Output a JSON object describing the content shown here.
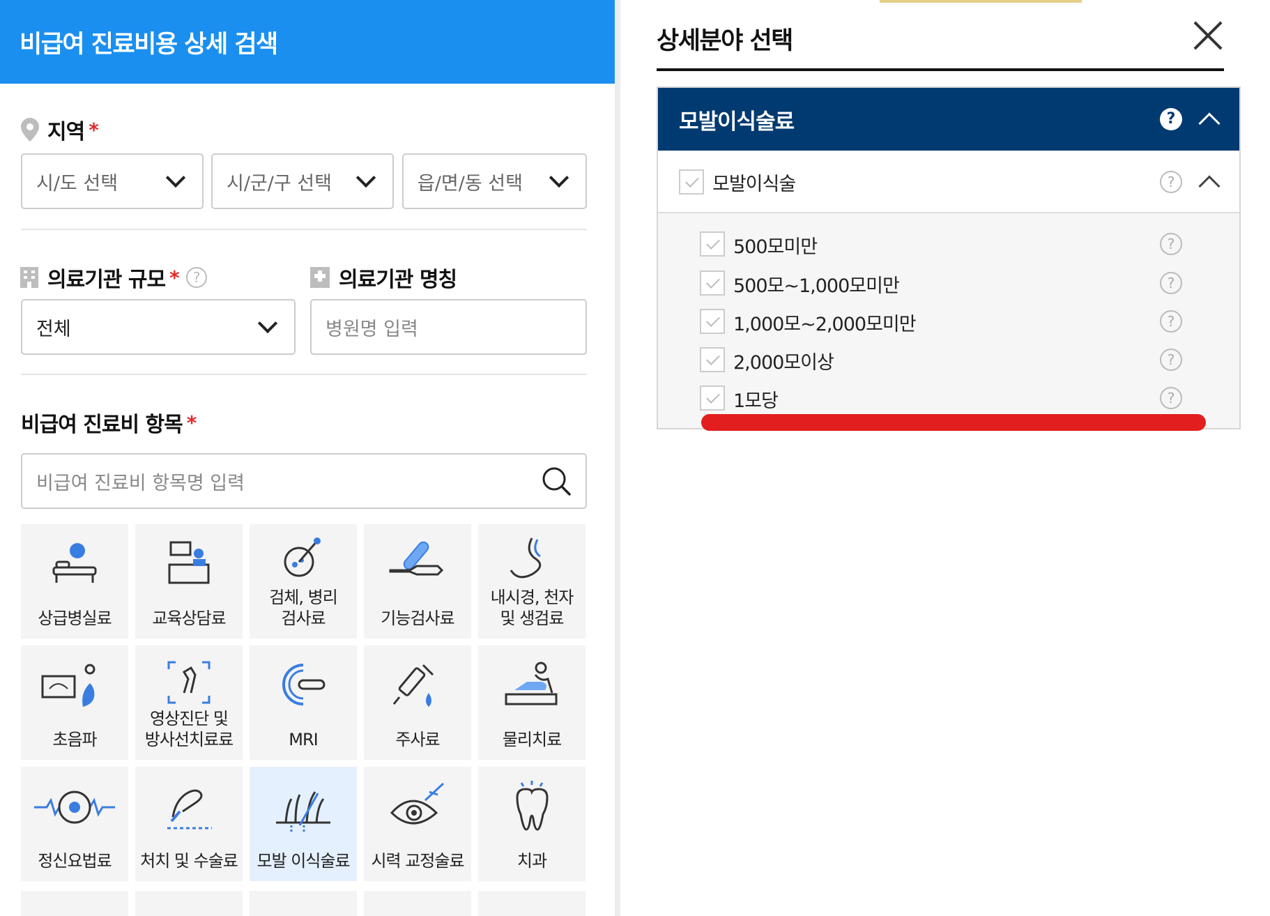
{
  "left": {
    "header_title": "비급여 진료비용 상세 검색",
    "region": {
      "label": "지역",
      "required_mark": "*",
      "sido_placeholder": "시/도 선택",
      "sigungu_placeholder": "시/군/구 선택",
      "dong_placeholder": "읍/면/동 선택"
    },
    "hospital_size": {
      "label": "의료기관 규모",
      "required_mark": "*",
      "help": "?",
      "value": "전체"
    },
    "hospital_name": {
      "label": "의료기관 명칭",
      "placeholder": "병원명 입력"
    },
    "items": {
      "label": "비급여 진료비 항목",
      "required_mark": "*",
      "search_placeholder": "비급여 진료비 항목명 입력",
      "tiles": [
        {
          "label": "상급병실료",
          "icon": "hospital-bed-icon"
        },
        {
          "label": "교육상담료",
          "icon": "counseling-desk-icon"
        },
        {
          "label": "검체, 병리\n검사료",
          "icon": "specimen-test-icon"
        },
        {
          "label": "기능검사료",
          "icon": "function-test-icon"
        },
        {
          "label": "내시경, 천자\n및 생검료",
          "icon": "endoscope-icon"
        },
        {
          "label": "초음파",
          "icon": "ultrasound-icon"
        },
        {
          "label": "영상진단 및\n방사선치료료",
          "icon": "xray-icon"
        },
        {
          "label": "MRI",
          "icon": "mri-icon"
        },
        {
          "label": "주사료",
          "icon": "syringe-icon"
        },
        {
          "label": "물리치료",
          "icon": "physio-icon"
        },
        {
          "label": "정신요법료",
          "icon": "brain-wave-icon"
        },
        {
          "label": "처치 및 수술료",
          "icon": "surgery-hand-icon"
        },
        {
          "label": "모발 이식술료",
          "icon": "hair-transplant-icon"
        },
        {
          "label": "시력 교정술료",
          "icon": "eye-laser-icon"
        },
        {
          "label": "치과",
          "icon": "tooth-icon"
        }
      ]
    }
  },
  "right": {
    "title": "상세분야 선택",
    "category": {
      "name": "모발이식술료",
      "help": "?"
    },
    "subcategory": {
      "name": "모발이식술",
      "help": "?"
    },
    "options": [
      {
        "label": "500모미만",
        "help": "?"
      },
      {
        "label": "500모~1,000모미만",
        "help": "?"
      },
      {
        "label": "1,000모~2,000모미만",
        "help": "?"
      },
      {
        "label": "2,000모이상",
        "help": "?"
      },
      {
        "label": "1모당",
        "help": "?"
      }
    ]
  },
  "colors": {
    "header_blue": "#1a8ff0",
    "category_navy": "#003a70",
    "required_red": "#e52a2a",
    "highlight_red": "#e21e1e",
    "active_tile": "#e4f0fd"
  }
}
